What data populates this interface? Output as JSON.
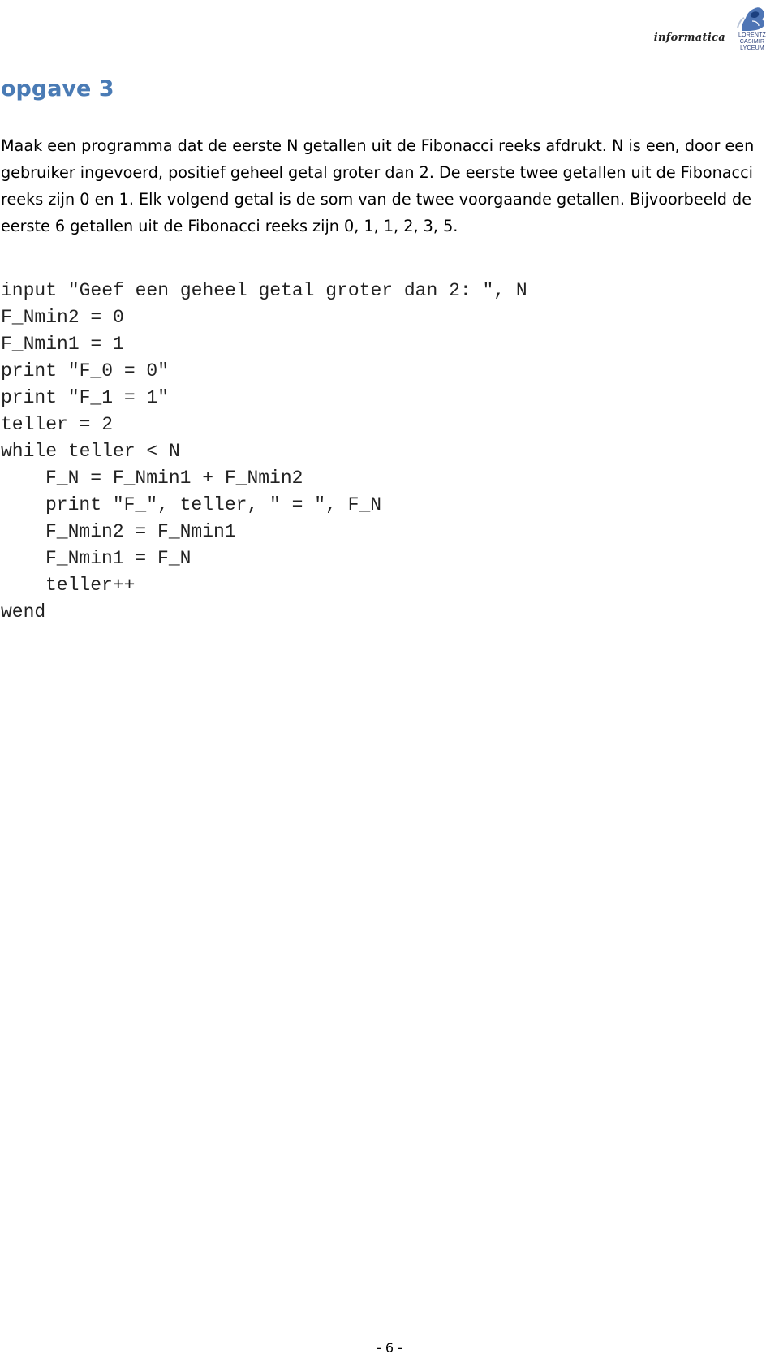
{
  "header": {
    "logo_text": "informatica",
    "school_lines": [
      "LORENTZ",
      "CASIMIR",
      "LYCEUM"
    ],
    "crest_icon": "school-crest-icon"
  },
  "title": "opgave 3",
  "title_color": "#4a7bb5",
  "intro_text": "Maak een programma dat de eerste N getallen uit de Fibonacci reeks afdrukt. N is een, door een gebruiker ingevoerd, positief geheel getal groter dan 2. De eerste twee getallen uit de Fibonacci reeks zijn 0 en 1. Elk volgend getal is de som van de twee voorgaande getallen. Bijvoorbeeld de eerste 6 getallen uit de Fibonacci reeks zijn 0, 1, 1, 2, 3, 5.",
  "code_lines": [
    {
      "text": "input \"Geef een geheel getal groter dan 2: \", N",
      "indent": 0
    },
    {
      "text": "F_Nmin2 = 0",
      "indent": 0
    },
    {
      "text": "F_Nmin1 = 1",
      "indent": 0
    },
    {
      "text": "print \"F_0 = 0\"",
      "indent": 0
    },
    {
      "text": "print \"F_1 = 1\"",
      "indent": 0
    },
    {
      "text": "teller = 2",
      "indent": 0
    },
    {
      "text": "while teller < N",
      "indent": 0
    },
    {
      "text": "F_N = F_Nmin1 + F_Nmin2",
      "indent": 1
    },
    {
      "text": "print \"F_\", teller, \" = \", F_N",
      "indent": 1
    },
    {
      "text": "F_Nmin2 = F_Nmin1",
      "indent": 1
    },
    {
      "text": "F_Nmin1 = F_N",
      "indent": 1
    },
    {
      "text": "teller++",
      "indent": 1
    },
    {
      "text": "wend",
      "indent": 0
    }
  ],
  "page_number": "- 6 -"
}
